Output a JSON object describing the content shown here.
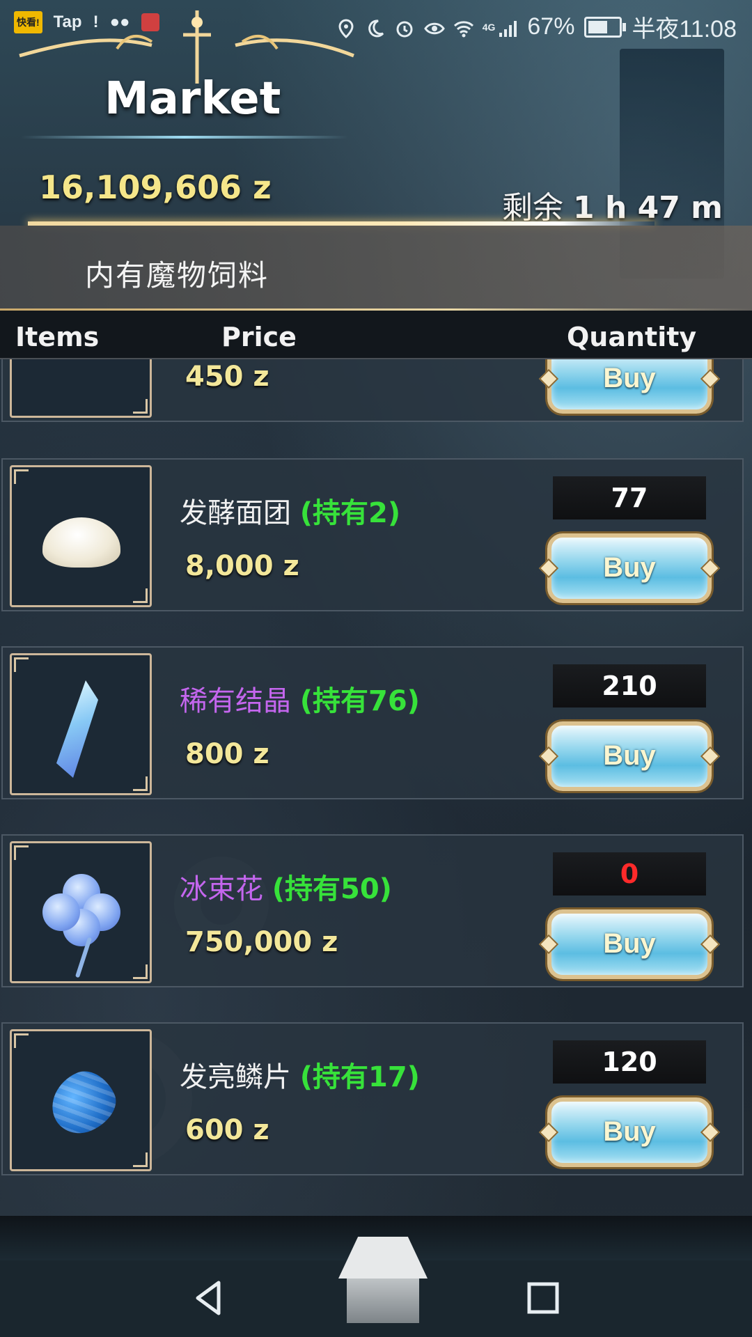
{
  "status_bar": {
    "left_badges": [
      "快看!",
      "Tap"
    ],
    "battery": "67%",
    "battery_level": 0.67,
    "network": "4G",
    "time": "半夜11:08"
  },
  "header": {
    "title": "Market",
    "money": "16,109,606 z",
    "time_left_prefix": "剩余",
    "time_left_value": "1 h 47 m",
    "subtitle": "内有魔物饲料"
  },
  "table_header": {
    "items": "Items",
    "price": "Price",
    "quantity": "Quantity"
  },
  "items": [
    {
      "name": "",
      "held": "",
      "price": "450 z",
      "quantity": "",
      "buy": "Buy",
      "icon": "partial-item-icon"
    },
    {
      "name": "发酵面团",
      "held": "(持有2)",
      "price": "8,000 z",
      "quantity": "77",
      "buy": "Buy",
      "icon": "dough-icon",
      "name_color": "#f1f1f1"
    },
    {
      "name": "稀有结晶",
      "held": "(持有76)",
      "price": "800 z",
      "quantity": "210",
      "buy": "Buy",
      "icon": "crystal-icon",
      "name_color": "#c466ee"
    },
    {
      "name": "冰束花",
      "held": "(持有50)",
      "price": "750,000 z",
      "quantity": "0",
      "buy": "Buy",
      "icon": "flower-icon",
      "name_color": "#c466ee",
      "quantity_color": "#ff2a2a"
    },
    {
      "name": "发亮鳞片",
      "held": "(持有17)",
      "price": "600 z",
      "quantity": "120",
      "buy": "Buy",
      "icon": "scale-icon",
      "name_color": "#f1f1f1"
    }
  ],
  "colors": {
    "held_green": "#37e23a",
    "price_yellow": "#f3e79a",
    "rare_purple": "#c466ee",
    "buy_blue": "#5cbde2"
  }
}
